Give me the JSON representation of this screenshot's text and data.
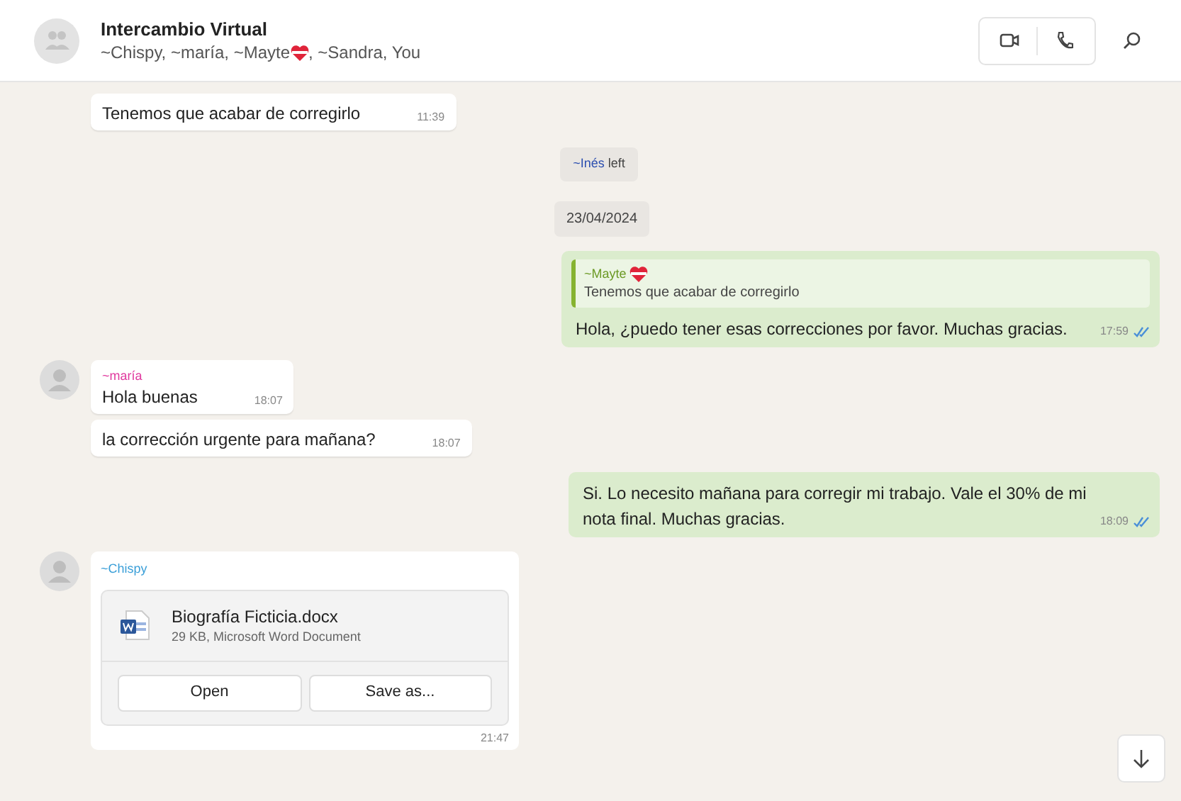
{
  "header": {
    "title": "Intercambio Virtual",
    "subtitle_before_heart": "~Chispy, ~maría, ~Mayte",
    "subtitle_after_heart": ", ~Sandra, You"
  },
  "messages": [
    {
      "kind": "incoming",
      "text": "Tenemos que acabar de corregirlo",
      "time": "11:39",
      "avatar": false
    },
    {
      "kind": "system",
      "name": "~Inés",
      "text": "left"
    },
    {
      "kind": "date",
      "text": "23/04/2024"
    },
    {
      "kind": "outgoing",
      "quote_sender": "~Mayte",
      "quote_text": "Tenemos que acabar de corregirlo",
      "text": "Hola, ¿puedo tener esas correcciones por favor. Muchas gracias.",
      "time": "17:59",
      "read": true
    },
    {
      "kind": "incoming",
      "sender": "~maría",
      "color": "#e0399e",
      "text": "Hola buenas",
      "time": "18:07",
      "avatar": true
    },
    {
      "kind": "incoming",
      "text": "la corrección urgente para mañana?",
      "time": "18:07",
      "avatar": false
    },
    {
      "kind": "outgoing",
      "text": "Si. Lo necesito mañana para corregir mi trabajo. Vale el 30% de mi nota final. Muchas gracias.",
      "time": "18:09",
      "read": true
    },
    {
      "kind": "file",
      "sender": "~Chispy",
      "color": "#3b9fd8",
      "file_name": "Biografía Ficticia.docx",
      "file_info": "29 KB, Microsoft Word Document",
      "buttons": [
        "Open",
        "Save as..."
      ],
      "time": "21:47",
      "avatar": true
    }
  ]
}
